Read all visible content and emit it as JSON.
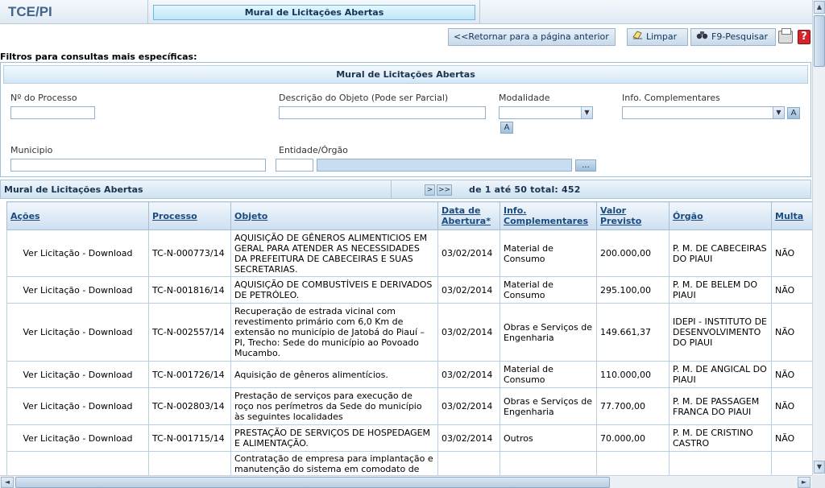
{
  "header": {
    "brand": "TCE/PI",
    "page_title": "Mural de Licitações Abertas"
  },
  "toolbar": {
    "back_label": "<<Retornar para a página anterior",
    "clear_label": "Limpar",
    "search_label": "F9-Pesquisar",
    "help_glyph": "?"
  },
  "filters": {
    "section_label": "Filtros para consultas mais específicas:",
    "title": "Mural de Licitações Abertas",
    "processo_label": "Nº do Processo",
    "descricao_label": "Descrição do Objeto (Pode ser Parcial)",
    "modalidade_label": "Modalidade",
    "info_label": "Info. Complementares",
    "municipio_label": "Municipio",
    "entidade_label": "Entidade/Órgão",
    "a_button": "A",
    "lookup_button": "..."
  },
  "grid": {
    "title": "Mural de Licitações Abertas",
    "next_btn": ">",
    "last_btn": ">>",
    "pager_text": "de  1  até  50  total: 452",
    "columns": [
      "Ações",
      "Processo",
      "Objeto",
      "Data de Abertura*",
      "Info. Complementares",
      "Valor Previsto",
      "Órgão",
      "Multa"
    ],
    "rows": [
      {
        "acao": "Ver Licitação - Download",
        "processo": "TC-N-000773/14",
        "objeto": "AQUISIÇÃO DE GÊNEROS ALIMENTICIOS EM GERAL PARA ATENDER AS NECESSIDADES DA PREFEITURA DE CABECEIRAS E SUAS SECRETARIAS.",
        "data": "03/02/2014",
        "info": "Material de Consumo",
        "valor": "200.000,00",
        "orgao": "P. M. DE CABECEIRAS DO PIAUI",
        "multa": "NÃO"
      },
      {
        "acao": "Ver Licitação - Download",
        "processo": "TC-N-001816/14",
        "objeto": "AQUISIÇÃO DE COMBUSTÍVEIS E DERIVADOS DE PETRÓLEO.",
        "data": "03/02/2014",
        "info": "Material de Consumo",
        "valor": "295.100,00",
        "orgao": "P. M. DE BELEM DO PIAUI",
        "multa": "NÃO"
      },
      {
        "acao": "Ver Licitação - Download",
        "processo": "TC-N-002557/14",
        "objeto": "Recuperação de estrada vicinal com revestimento primário com 6,0 Km de extensão no município de Jatobá do Piauí – PI, Trecho: Sede do município ao Povoado Mucambo.",
        "data": "03/02/2014",
        "info": "Obras e Serviços de Engenharia",
        "valor": "149.661,37",
        "orgao": "IDEPI - INSTITUTO DE DESENVOLVIMENTO DO PIAUI",
        "multa": "NÃO"
      },
      {
        "acao": "Ver Licitação - Download",
        "processo": "TC-N-001726/14",
        "objeto": "Aquisição de gêneros alimentícios.",
        "data": "03/02/2014",
        "info": "Material de Consumo",
        "valor": "110.000,00",
        "orgao": "P. M. DE ANGICAL DO PIAUI",
        "multa": "NÃO"
      },
      {
        "acao": "Ver Licitação - Download",
        "processo": "TC-N-002803/14",
        "objeto": "Prestação de serviços para execução de roço nos perímetros da Sede do município às seguintes localidades",
        "data": "03/02/2014",
        "info": "Obras e Serviços de Engenharia",
        "valor": "77.700,00",
        "orgao": "P. M. DE PASSAGEM FRANCA DO PIAUI",
        "multa": "NÃO"
      },
      {
        "acao": "Ver Licitação - Download",
        "processo": "TC-N-001715/14",
        "objeto": "PRESTAÇÃO DE SERVIÇOS DE HOSPEDAGEM E ALIMENTAÇÃO.",
        "data": "03/02/2014",
        "info": "Outros",
        "valor": "70.000,00",
        "orgao": "P. M. DE CRISTINO CASTRO",
        "multa": "NÃO"
      },
      {
        "acao": "",
        "processo": "",
        "objeto": "Contratação de empresa para implantação e manutenção do sistema em comodato de",
        "data": "",
        "info": "",
        "valor": "",
        "orgao": "",
        "multa": ""
      }
    ]
  },
  "scrollbars": {
    "up": "▲",
    "down": "▼",
    "left": "◄",
    "right": "►",
    "select_arrow": "▼"
  }
}
